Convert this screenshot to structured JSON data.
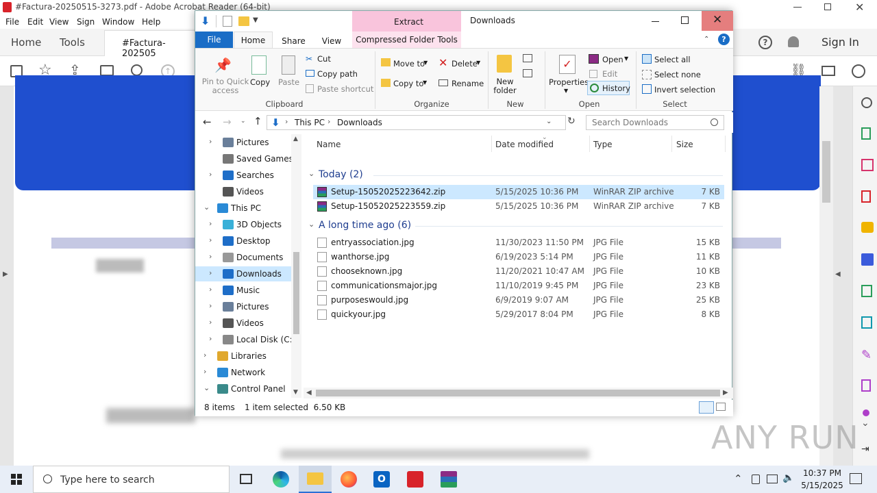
{
  "acrobat": {
    "title": "#Factura-20250515-3273.pdf - Adobe Acrobat Reader (64-bit)",
    "menu": [
      "File",
      "Edit",
      "View",
      "Sign",
      "Window",
      "Help"
    ],
    "home": "Home",
    "tools": "Tools",
    "doc_tab": "#Factura-202505",
    "sign_in": "Sign In"
  },
  "explorer": {
    "title": "Downloads",
    "context_tab": "Extract",
    "tabs": {
      "file": "File",
      "home": "Home",
      "share": "Share",
      "view": "View",
      "compressed": "Compressed Folder Tools"
    },
    "ribbon": {
      "pin": "Pin to Quick access",
      "copy": "Copy",
      "paste": "Paste",
      "cut": "Cut",
      "copy_path": "Copy path",
      "paste_shortcut": "Paste shortcut",
      "clipboard": "Clipboard",
      "move_to": "Move to",
      "copy_to": "Copy to",
      "delete": "Delete",
      "rename": "Rename",
      "organize": "Organize",
      "new_folder": "New folder",
      "new": "New",
      "properties": "Properties",
      "open": "Open",
      "edit": "Edit",
      "history": "History",
      "open_grp": "Open",
      "select_all": "Select all",
      "select_none": "Select none",
      "invert": "Invert selection",
      "select": "Select"
    },
    "address": {
      "this_pc": "This PC",
      "downloads": "Downloads",
      "search_placeholder": "Search Downloads"
    },
    "nav": [
      {
        "label": "Pictures"
      },
      {
        "label": "Saved Games"
      },
      {
        "label": "Searches"
      },
      {
        "label": "Videos"
      },
      {
        "label": "This PC"
      },
      {
        "label": "3D Objects"
      },
      {
        "label": "Desktop"
      },
      {
        "label": "Documents"
      },
      {
        "label": "Downloads"
      },
      {
        "label": "Music"
      },
      {
        "label": "Pictures"
      },
      {
        "label": "Videos"
      },
      {
        "label": "Local Disk (C:)"
      },
      {
        "label": "Libraries"
      },
      {
        "label": "Network"
      },
      {
        "label": "Control Panel"
      }
    ],
    "columns": {
      "name": "Name",
      "date": "Date modified",
      "type": "Type",
      "size": "Size"
    },
    "groups": {
      "today": "Today (2)",
      "long_ago": "A long time ago (6)"
    },
    "files": [
      {
        "name": "Setup-15052025223642.zip",
        "date": "5/15/2025 10:36 PM",
        "type": "WinRAR ZIP archive",
        "size": "7 KB"
      },
      {
        "name": "Setup-15052025223559.zip",
        "date": "5/15/2025 10:36 PM",
        "type": "WinRAR ZIP archive",
        "size": "7 KB"
      },
      {
        "name": "entryassociation.jpg",
        "date": "11/30/2023 11:50 PM",
        "type": "JPG File",
        "size": "15 KB"
      },
      {
        "name": "wanthorse.jpg",
        "date": "6/19/2023 5:14 PM",
        "type": "JPG File",
        "size": "11 KB"
      },
      {
        "name": "chooseknown.jpg",
        "date": "11/20/2021 10:47 AM",
        "type": "JPG File",
        "size": "10 KB"
      },
      {
        "name": "communicationsmajor.jpg",
        "date": "11/10/2019 9:45 PM",
        "type": "JPG File",
        "size": "23 KB"
      },
      {
        "name": "purposeswould.jpg",
        "date": "6/9/2019 9:07 AM",
        "type": "JPG File",
        "size": "25 KB"
      },
      {
        "name": "quickyour.jpg",
        "date": "5/29/2017 8:04 PM",
        "type": "JPG File",
        "size": "8 KB"
      }
    ],
    "status": {
      "count": "8 items",
      "selected": "1 item selected  6.50 KB"
    }
  },
  "taskbar": {
    "search_placeholder": "Type here to search",
    "time": "10:37 PM",
    "date": "5/15/2025"
  },
  "watermark": "ANY RUN"
}
